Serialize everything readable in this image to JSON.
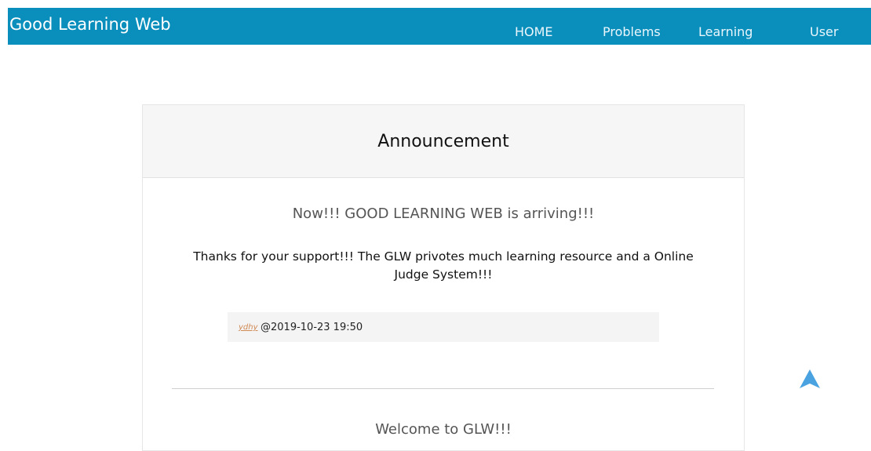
{
  "navbar": {
    "brand": "Good Learning Web",
    "items": [
      {
        "label": "HOME"
      },
      {
        "label": "Problems"
      },
      {
        "label": "Learning"
      },
      {
        "label": "User"
      }
    ],
    "bg_color": "#0a8fbd"
  },
  "panel": {
    "title": "Announcement",
    "announcements": [
      {
        "headline": "Now!!! GOOD LEARNING WEB is arriving!!!",
        "body": "Thanks for your support!!! The GLW privotes much learning resource and a Online Judge System!!!",
        "author": "ydhy",
        "date": "@2019-10-23 19:50"
      },
      {
        "headline": "Welcome to GLW!!!"
      }
    ]
  },
  "back_to_top": {
    "icon": "arrow-up-icon",
    "color": "#4aa3e0"
  }
}
